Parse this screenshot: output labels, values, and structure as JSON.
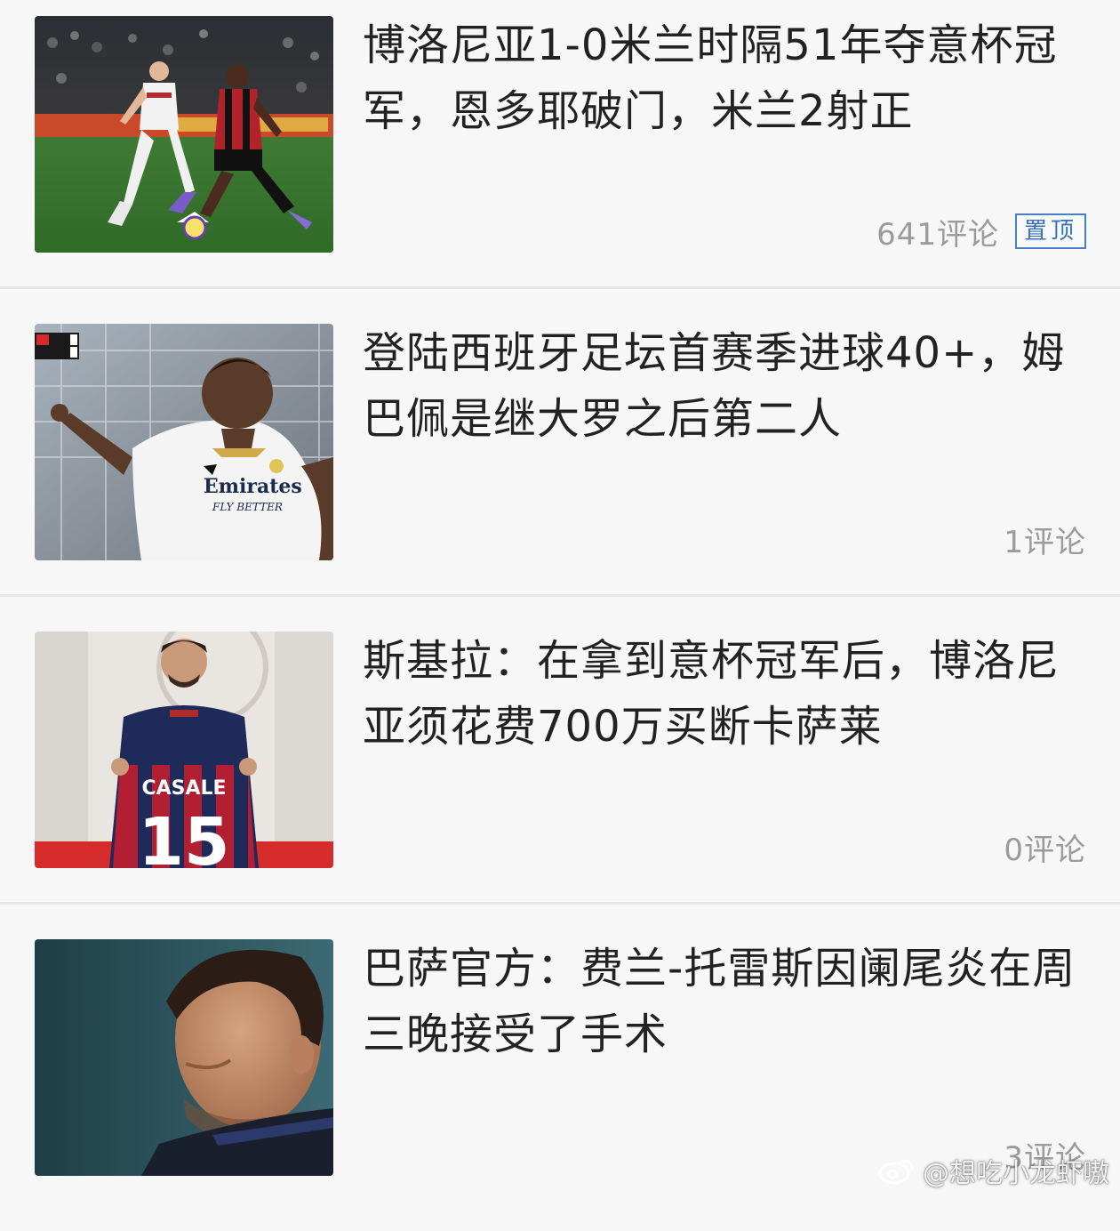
{
  "feed": {
    "items": [
      {
        "title": "博洛尼亚1-0米兰时隔51年夺意杯冠军，恩多耶破门，米兰2射正",
        "comments": "641评论",
        "badge": "置顶",
        "image": "photo-bologna-vs-milan-match"
      },
      {
        "title": "登陆西班牙足坛首赛季进球40+，姆巴佩是继大罗之后第二人",
        "comments": "1评论",
        "image": "photo-mbappe-real-madrid",
        "image_text": {
          "shirt_sponsor": "Emirates",
          "shirt_slogan": "FLY BETTER"
        }
      },
      {
        "title": "斯基拉：在拿到意杯冠军后，博洛尼亚须花费700万买断卡萨莱",
        "comments": "0评论",
        "image": "photo-casale-bologna-jersey",
        "image_text": {
          "jersey_name": "CASALE",
          "jersey_number": "15"
        }
      },
      {
        "title": "巴萨官方：费兰-托雷斯因阑尾炎在周三晚接受了手术",
        "comments": "3评论",
        "image": "photo-ferran-torres-portrait"
      }
    ]
  },
  "watermark": {
    "text": "@想吃小龙虾嗷",
    "icon": "weibo-logo-icon"
  }
}
